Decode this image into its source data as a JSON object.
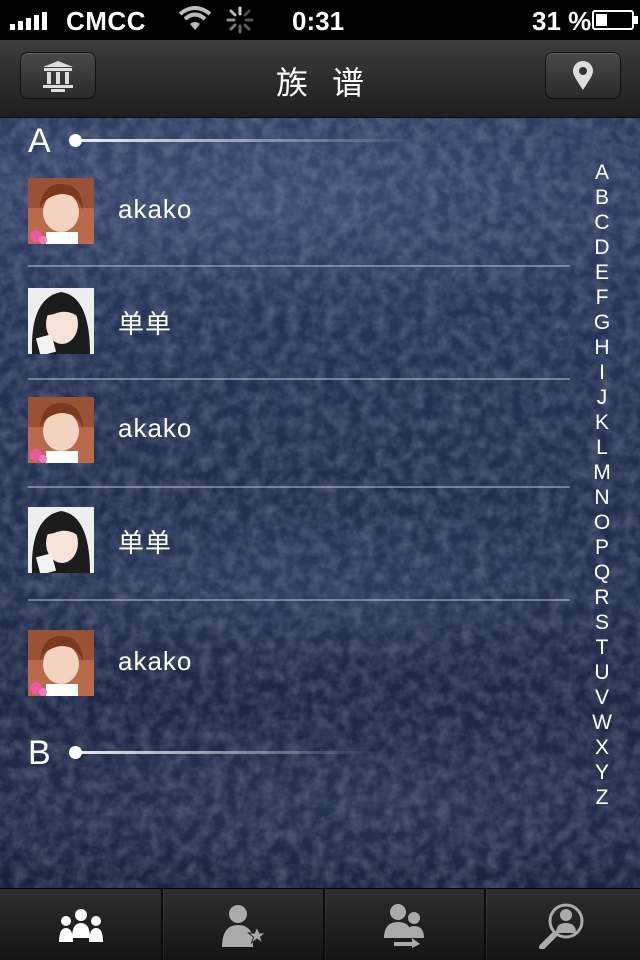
{
  "status_bar": {
    "carrier": "CMCC",
    "time": "0:31",
    "battery_percent_label": "31 %",
    "battery_level": 0.31,
    "icons": [
      "signal-icon",
      "wifi-icon",
      "loading-spinner-icon",
      "battery-icon"
    ]
  },
  "nav": {
    "title": "族谱",
    "left_icon": "building-icon",
    "right_icon": "location-pin-icon"
  },
  "sections": [
    {
      "letter": "A"
    },
    {
      "letter": "B"
    }
  ],
  "contacts": [
    {
      "name": "akako"
    },
    {
      "name": "单单"
    },
    {
      "name": "akako"
    },
    {
      "name": "单单"
    },
    {
      "name": "akako"
    }
  ],
  "index": [
    "A",
    "B",
    "C",
    "D",
    "E",
    "F",
    "G",
    "H",
    "I",
    "J",
    "K",
    "L",
    "M",
    "N",
    "O",
    "P",
    "Q",
    "R",
    "S",
    "T",
    "U",
    "V",
    "W",
    "X",
    "Y",
    "Z"
  ],
  "tabs": [
    {
      "icon": "family-group-icon",
      "selected": true
    },
    {
      "icon": "favorite-person-icon",
      "selected": false
    },
    {
      "icon": "person-transfer-icon",
      "selected": false
    },
    {
      "icon": "person-search-icon",
      "selected": false
    }
  ],
  "colors": {
    "background": "#1f2c4c",
    "nav_bar": "#2a2a2a",
    "text": "#ffffff"
  }
}
